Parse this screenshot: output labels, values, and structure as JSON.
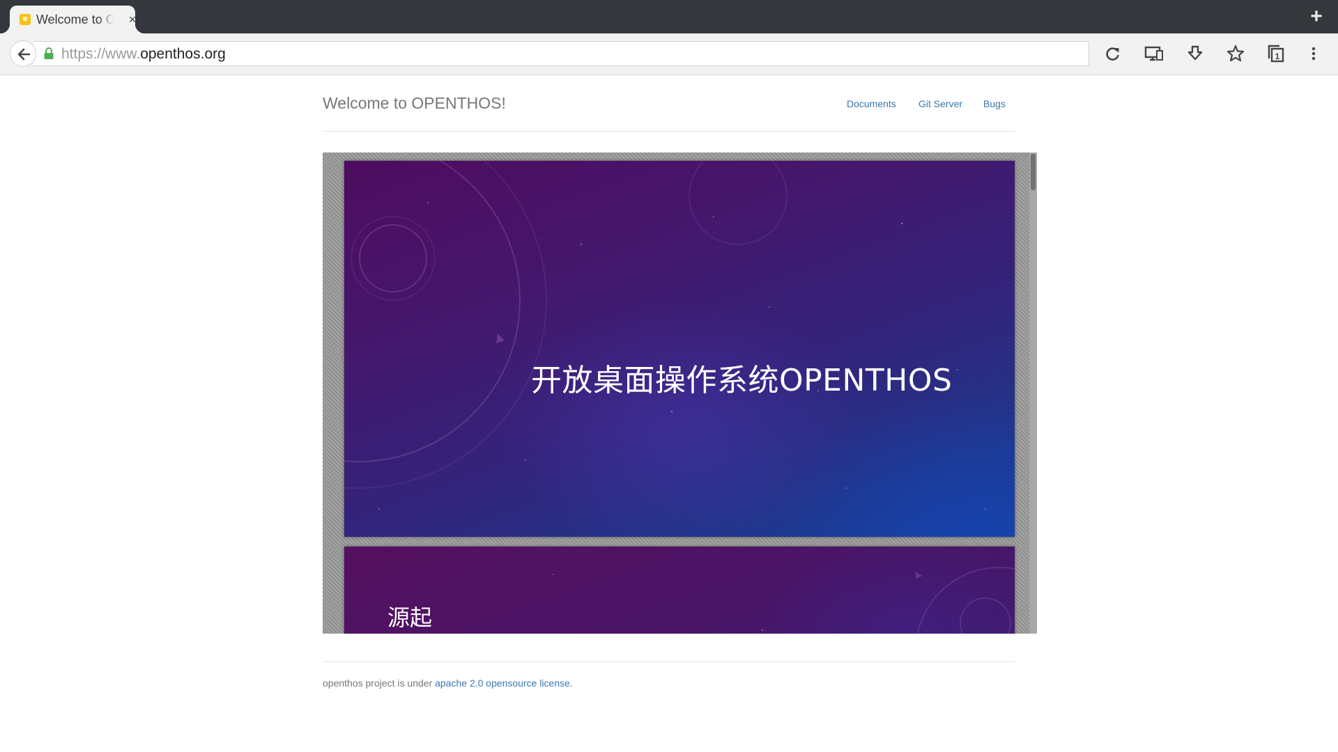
{
  "browser": {
    "tab": {
      "title": "Welcome to OPENTHOS!",
      "close_glyph": "×",
      "favicon": "page-favicon"
    },
    "new_tab_glyph": "+",
    "address": {
      "scheme_prefix": "https://www.",
      "domain": "openthos.org"
    },
    "toolbar_icons": [
      "reload-icon",
      "desktop-view-icon",
      "download-icon",
      "star-icon",
      "tabs-count-icon",
      "more-menu-icon"
    ],
    "tabs_count": "1"
  },
  "page": {
    "title": "Welcome to OPENTHOS!",
    "nav": [
      {
        "label": "Documents"
      },
      {
        "label": "Git Server"
      },
      {
        "label": "Bugs"
      }
    ],
    "slides": [
      {
        "title": "开放桌面操作系统OPENTHOS"
      },
      {
        "title": "源起"
      }
    ],
    "footer": {
      "text_before": "openthos project is under ",
      "link": "apache 2.0 opensource license",
      "text_after": "."
    }
  },
  "colors": {
    "tabstrip": "#34373b",
    "toolbar": "#f2f2f2",
    "link": "#3877b1",
    "header_text": "#777777",
    "lock": "#4caf50"
  }
}
